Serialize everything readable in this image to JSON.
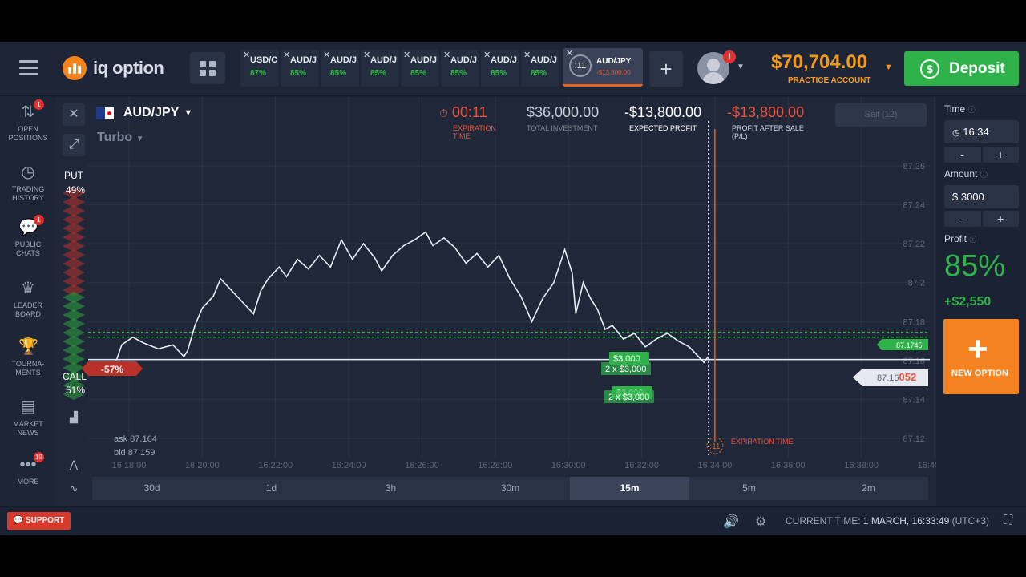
{
  "header": {
    "logo_text": "iq option",
    "asset_tabs": [
      {
        "name": "USD/C",
        "pct": "87%"
      },
      {
        "name": "AUD/J",
        "pct": "85%"
      },
      {
        "name": "AUD/J",
        "pct": "85%"
      },
      {
        "name": "AUD/J",
        "pct": "85%"
      },
      {
        "name": "AUD/J",
        "pct": "85%"
      },
      {
        "name": "AUD/J",
        "pct": "85%"
      },
      {
        "name": "AUD/J",
        "pct": "85%"
      },
      {
        "name": "AUD/J",
        "pct": "85%"
      }
    ],
    "active_tab": {
      "timer": ":11",
      "name": "AUD/JPY",
      "pl": "-$13,800.00"
    },
    "plus": "+",
    "notification_count": "!",
    "balance": "$70,704.00",
    "account_type": "PRACTICE ACCOUNT",
    "deposit_label": "Deposit"
  },
  "sidebar": {
    "items": [
      {
        "label": "OPEN\nPOSITIONS",
        "badge": "1"
      },
      {
        "label": "TRADING\nHISTORY",
        "badge": ""
      },
      {
        "label": "PUBLIC\nCHATS",
        "badge": "1"
      },
      {
        "label": "LEADER\nBOARD",
        "badge": ""
      },
      {
        "label": "TOURNA-\nMENTS",
        "badge": ""
      },
      {
        "label": "MARKET\nNEWS",
        "badge": ""
      },
      {
        "label": "MORE",
        "badge": "19"
      }
    ]
  },
  "trade": {
    "pair": "AUD/JPY",
    "mode": "Turbo",
    "expiration": "00:11",
    "expiration_label": "EXPIRATION TIME",
    "total_investment": "$36,000.00",
    "total_investment_label": "TOTAL INVESTMENT",
    "expected_profit": "-$13,800.00",
    "expected_profit_label": "EXPECTED PROFIT",
    "profit_after_sale": "-$13,800.00",
    "profit_after_sale_label": "PROFIT AFTER SALE (P/L)",
    "sell_label": "Sell (12)",
    "put_label": "PUT",
    "put_pct": "49%",
    "call_label": "CALL",
    "call_pct": "51%",
    "ask": "ask 87.164",
    "bid": "bid 87.159",
    "neg_pct": "-57%",
    "deal_labels": [
      "$3,000",
      "2 x $3,000",
      "$3,000",
      "2 x $3,000"
    ],
    "deal_price": "87.1745",
    "current_price": "87.16052",
    "expiry_marker": ":11",
    "expiry_marker_label": "EXPIRATION TIME"
  },
  "timeframes": [
    "30d",
    "1d",
    "3h",
    "30m",
    "15m",
    "5m",
    "2m"
  ],
  "active_timeframe": "15m",
  "right_panel": {
    "time_label": "Time",
    "time_value": "16:34",
    "amount_label": "Amount",
    "amount_value": "$ 3000",
    "profit_label": "Profit",
    "profit_pct": "85%",
    "profit_amount": "+$2,550",
    "new_option_label": "NEW OPTION",
    "minus": "-",
    "plus": "+"
  },
  "footer": {
    "support_label": "SUPPORT",
    "current_time_label": "CURRENT TIME:",
    "current_time_value": "1 MARCH, 16:33:49",
    "tz": "(UTC+3)"
  },
  "colors": {
    "accent": "#f58220",
    "green": "#2fb24a",
    "red": "#e8523a"
  },
  "chart_data": {
    "type": "line",
    "x_ticks": [
      "16:18:00",
      "16:20:00",
      "16:22:00",
      "16:24:00",
      "16:26:00",
      "16:28:00",
      "16:30:00",
      "16:32:00",
      "16:34:00",
      "16:36:00",
      "16:38:00",
      "16:40:00"
    ],
    "y_ticks": [
      "87.26",
      "87.24",
      "87.22",
      "87.2",
      "87.18",
      "87.16",
      "87.14",
      "87.12"
    ],
    "ylim": [
      87.11,
      87.27
    ],
    "series": [
      {
        "x": [
          "16:17:36",
          "16:17:48",
          "16:18:06",
          "16:18:24",
          "16:18:48",
          "16:19:12",
          "16:19:30",
          "16:19:36",
          "16:19:48",
          "16:20:00",
          "16:20:18",
          "16:20:30",
          "16:20:48",
          "16:21:06",
          "16:21:24",
          "16:21:36",
          "16:21:48",
          "16:22:06",
          "16:22:18",
          "16:22:36",
          "16:22:54",
          "16:23:12",
          "16:23:30",
          "16:23:48",
          "16:24:06",
          "16:24:24",
          "16:24:42",
          "16:24:54",
          "16:25:12",
          "16:25:30",
          "16:25:48",
          "16:26:06",
          "16:26:18",
          "16:26:36",
          "16:26:54",
          "16:27:12",
          "16:27:30",
          "16:27:48",
          "16:28:06",
          "16:28:24",
          "16:28:42",
          "16:29:00",
          "16:29:18",
          "16:29:36",
          "16:29:54",
          "16:30:06",
          "16:30:12",
          "16:30:24",
          "16:30:36",
          "16:30:48",
          "16:31:00",
          "16:31:12",
          "16:31:30",
          "16:31:48",
          "16:32:06",
          "16:32:24",
          "16:32:42",
          "16:33:00",
          "16:33:12",
          "16:33:18",
          "16:33:30",
          "16:33:42",
          "16:33:49"
        ],
        "y": [
          87.157,
          87.168,
          87.172,
          87.169,
          87.166,
          87.168,
          87.162,
          87.165,
          87.178,
          87.187,
          87.193,
          87.202,
          87.196,
          87.19,
          87.184,
          87.196,
          87.202,
          87.208,
          87.203,
          87.212,
          87.207,
          87.214,
          87.208,
          87.222,
          87.212,
          87.22,
          87.213,
          87.206,
          87.214,
          87.219,
          87.222,
          87.226,
          87.219,
          87.223,
          87.218,
          87.21,
          87.215,
          87.208,
          87.214,
          87.202,
          87.193,
          87.18,
          87.192,
          87.2,
          87.217,
          87.205,
          87.184,
          87.2,
          87.192,
          87.186,
          87.176,
          87.178,
          87.171,
          87.174,
          87.167,
          87.171,
          87.174,
          87.17,
          87.168,
          87.167,
          87.163,
          87.159,
          87.162
        ]
      }
    ],
    "deal_lines": [
      87.1745,
      87.172,
      87.16052
    ],
    "current_time": "16:33:49",
    "expiration_time": "16:34:00",
    "grid": true
  }
}
